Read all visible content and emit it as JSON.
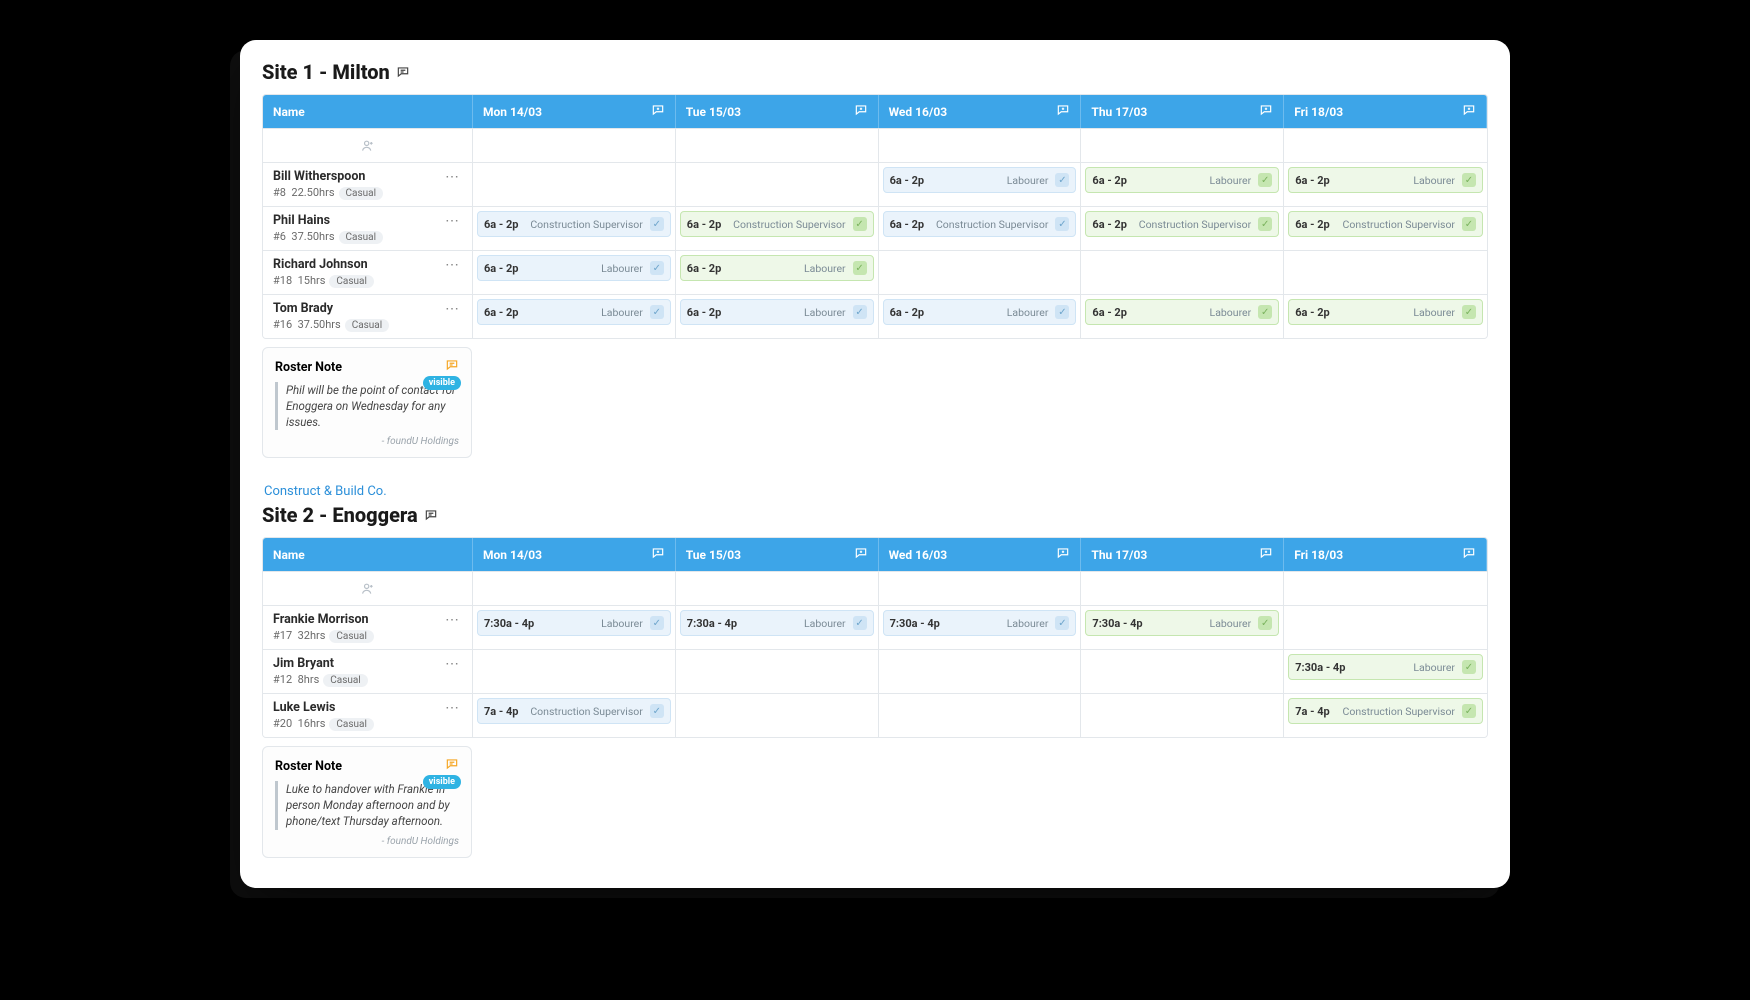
{
  "columns": {
    "name_header": "Name",
    "days": [
      "Mon 14/03",
      "Tue 15/03",
      "Wed 16/03",
      "Thu 17/03",
      "Fri 18/03"
    ]
  },
  "sites": [
    {
      "title": "Site 1 - Milton",
      "company": "",
      "employees": [
        {
          "name": "Bill Witherspoon",
          "id": "#8",
          "hours": "22.50hrs",
          "tag": "Casual",
          "shifts": [
            null,
            null,
            {
              "time": "6a  -  2p",
              "role": "Labourer",
              "c": "blue"
            },
            {
              "time": "6a  -  2p",
              "role": "Labourer",
              "c": "green"
            },
            {
              "time": "6a  -  2p",
              "role": "Labourer",
              "c": "green"
            }
          ]
        },
        {
          "name": "Phil Hains",
          "id": "#6",
          "hours": "37.50hrs",
          "tag": "Casual",
          "shifts": [
            {
              "time": "6a  -  2p",
              "role": "Construction Supervisor",
              "c": "blue"
            },
            {
              "time": "6a  -  2p",
              "role": "Construction Supervisor",
              "c": "green"
            },
            {
              "time": "6a  -  2p",
              "role": "Construction Supervisor",
              "c": "blue"
            },
            {
              "time": "6a  -  2p",
              "role": "Construction Supervisor",
              "c": "green"
            },
            {
              "time": "6a  -  2p",
              "role": "Construction Supervisor",
              "c": "green"
            }
          ]
        },
        {
          "name": "Richard Johnson",
          "id": "#18",
          "hours": "15hrs",
          "tag": "Casual",
          "shifts": [
            {
              "time": "6a  -  2p",
              "role": "Labourer",
              "c": "blue"
            },
            {
              "time": "6a  -  2p",
              "role": "Labourer",
              "c": "green"
            },
            null,
            null,
            null
          ]
        },
        {
          "name": "Tom Brady",
          "id": "#16",
          "hours": "37.50hrs",
          "tag": "Casual",
          "shifts": [
            {
              "time": "6a  -  2p",
              "role": "Labourer",
              "c": "blue"
            },
            {
              "time": "6a  -  2p",
              "role": "Labourer",
              "c": "blue"
            },
            {
              "time": "6a  -  2p",
              "role": "Labourer",
              "c": "blue"
            },
            {
              "time": "6a  -  2p",
              "role": "Labourer",
              "c": "green"
            },
            {
              "time": "6a  -  2p",
              "role": "Labourer",
              "c": "green"
            }
          ]
        }
      ],
      "note": {
        "title": "Roster Note",
        "visible_label": "visible",
        "body": "Phil will be the point of contact for Enoggera on Wednesday for any issues.",
        "footer": "- foundU Holdings"
      }
    },
    {
      "title": "Site 2 - Enoggera",
      "company": "Construct & Build Co.",
      "employees": [
        {
          "name": "Frankie Morrison",
          "id": "#17",
          "hours": "32hrs",
          "tag": "Casual",
          "shifts": [
            {
              "time": "7:30a  -  4p",
              "role": "Labourer",
              "c": "blue"
            },
            {
              "time": "7:30a  -  4p",
              "role": "Labourer",
              "c": "blue"
            },
            {
              "time": "7:30a  -  4p",
              "role": "Labourer",
              "c": "blue"
            },
            {
              "time": "7:30a  -  4p",
              "role": "Labourer",
              "c": "green"
            },
            null
          ]
        },
        {
          "name": "Jim Bryant",
          "id": "#12",
          "hours": "8hrs",
          "tag": "Casual",
          "shifts": [
            null,
            null,
            null,
            null,
            {
              "time": "7:30a  -  4p",
              "role": "Labourer",
              "c": "green"
            }
          ]
        },
        {
          "name": "Luke Lewis",
          "id": "#20",
          "hours": "16hrs",
          "tag": "Casual",
          "shifts": [
            {
              "time": "7a  -  4p",
              "role": "Construction Supervisor",
              "c": "blue"
            },
            null,
            null,
            null,
            {
              "time": "7a  -  4p",
              "role": "Construction Supervisor",
              "c": "green"
            }
          ]
        }
      ],
      "note": {
        "title": "Roster Note",
        "visible_label": "visible",
        "body": "Luke to handover with Frankie in person Monday afternoon and by phone/text Thursday afternoon.",
        "footer": "- foundU Holdings"
      }
    }
  ]
}
